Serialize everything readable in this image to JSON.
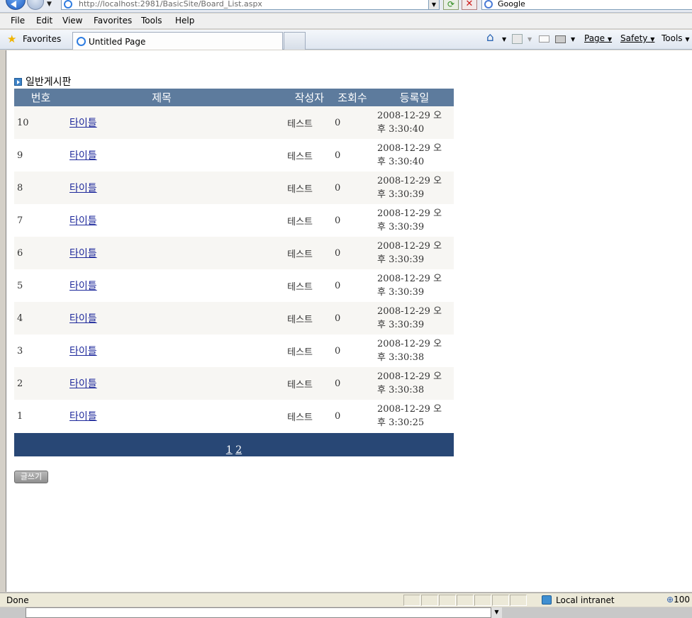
{
  "browser": {
    "address_url": "http://localhost:2981/BasicSite/Board_List.aspx",
    "search_placeholder": "Google",
    "menu": [
      "File",
      "Edit",
      "View",
      "Favorites",
      "Tools",
      "Help"
    ],
    "favorites_label": "Favorites",
    "tab_title": "Untitled Page",
    "commands": {
      "page": "Page",
      "safety": "Safety",
      "tools": "Tools"
    },
    "status_text": "Done",
    "zone_text": "Local intranet",
    "zoom_text": "100"
  },
  "board": {
    "title": "일반게시판",
    "columns": [
      "번호",
      "제목",
      "작성자",
      "조회수",
      "등록일"
    ],
    "rows": [
      {
        "no": "10",
        "title": "타이틀",
        "writer": "테스트",
        "views": "0",
        "date_line1": "2008-12-29 오",
        "date_line2": "후 3:30:40"
      },
      {
        "no": "9",
        "title": "타이틀",
        "writer": "테스트",
        "views": "0",
        "date_line1": "2008-12-29 오",
        "date_line2": "후 3:30:40"
      },
      {
        "no": "8",
        "title": "타이틀",
        "writer": "테스트",
        "views": "0",
        "date_line1": "2008-12-29 오",
        "date_line2": "후 3:30:39"
      },
      {
        "no": "7",
        "title": "타이틀",
        "writer": "테스트",
        "views": "0",
        "date_line1": "2008-12-29 오",
        "date_line2": "후 3:30:39"
      },
      {
        "no": "6",
        "title": "타이틀",
        "writer": "테스트",
        "views": "0",
        "date_line1": "2008-12-29 오",
        "date_line2": "후 3:30:39"
      },
      {
        "no": "5",
        "title": "타이틀",
        "writer": "테스트",
        "views": "0",
        "date_line1": "2008-12-29 오",
        "date_line2": "후 3:30:39"
      },
      {
        "no": "4",
        "title": "타이틀",
        "writer": "테스트",
        "views": "0",
        "date_line1": "2008-12-29 오",
        "date_line2": "후 3:30:39"
      },
      {
        "no": "3",
        "title": "타이틀",
        "writer": "테스트",
        "views": "0",
        "date_line1": "2008-12-29 오",
        "date_line2": "후 3:30:38"
      },
      {
        "no": "2",
        "title": "타이틀",
        "writer": "테스트",
        "views": "0",
        "date_line1": "2008-12-29 오",
        "date_line2": "후 3:30:38"
      },
      {
        "no": "1",
        "title": "타이틀",
        "writer": "테스트",
        "views": "0",
        "date_line1": "2008-12-29 오",
        "date_line2": "후 3:30:25"
      }
    ],
    "pager": {
      "current": "1",
      "next": "2"
    },
    "write_button": "글쓰기"
  },
  "colors": {
    "header_bg": "#5d7b9d",
    "pager_bg": "#284775",
    "alt_row_bg": "#f7f6f3"
  }
}
